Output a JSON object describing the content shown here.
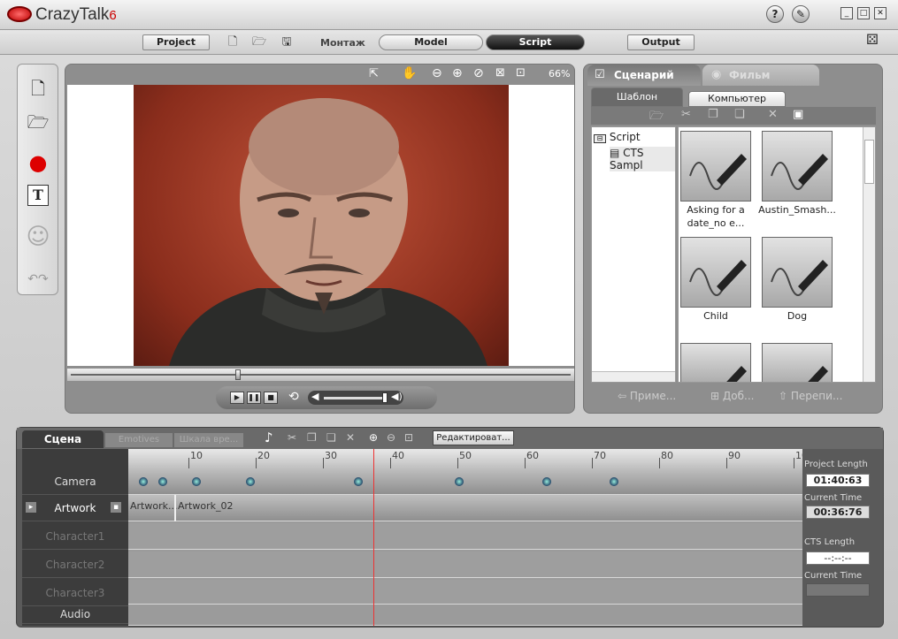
{
  "app": {
    "name": "CrazyTalk",
    "version": "6"
  },
  "title_buttons": {
    "help": "?",
    "settings": "tools"
  },
  "modebar": {
    "project": "Project",
    "montage": "Монтаж",
    "model": "Model",
    "script": "Script",
    "output": "Output"
  },
  "viewer": {
    "zoom": "66%",
    "scrub_position": 0.33
  },
  "right_panel": {
    "tab_scenario": "Сценарий",
    "tab_film": "Фильм",
    "subtab_template": "Шаблон",
    "subtab_computer": "Компьютер",
    "tree": [
      "Script",
      "CTS Sampl"
    ],
    "thumbs": [
      "Asking for a date_no e...",
      "Austin_Smash...",
      "Child",
      "Dog"
    ],
    "actions": [
      "Приме...",
      "Доб...",
      "Перепи..."
    ]
  },
  "timeline": {
    "tab_scene": "Сцена",
    "tab_emotives": "Emotives",
    "tab_scale": "Шкала вре...",
    "edit_button": "Редактироват...",
    "ruler": [
      "10",
      "20",
      "30",
      "40",
      "50",
      "60",
      "70",
      "80",
      "90",
      "10"
    ],
    "tracks": [
      "Camera",
      "Artwork",
      "Character1",
      "Character2",
      "Character3",
      "Audio"
    ],
    "artwork_clips": [
      "Artwork...",
      "Artwork_02"
    ],
    "camera_keys": [
      1,
      4,
      9,
      17,
      33,
      48,
      61,
      71
    ],
    "playhead": 36.76,
    "project_length_label": "Project Length",
    "project_length": "01:40:63",
    "current_time_label": "Current Time",
    "current_time": "00:36:76",
    "cts_length_label": "CTS Length",
    "cts_length": "--:--:--",
    "current_time2_label": "Current Time",
    "current_time2": ""
  }
}
